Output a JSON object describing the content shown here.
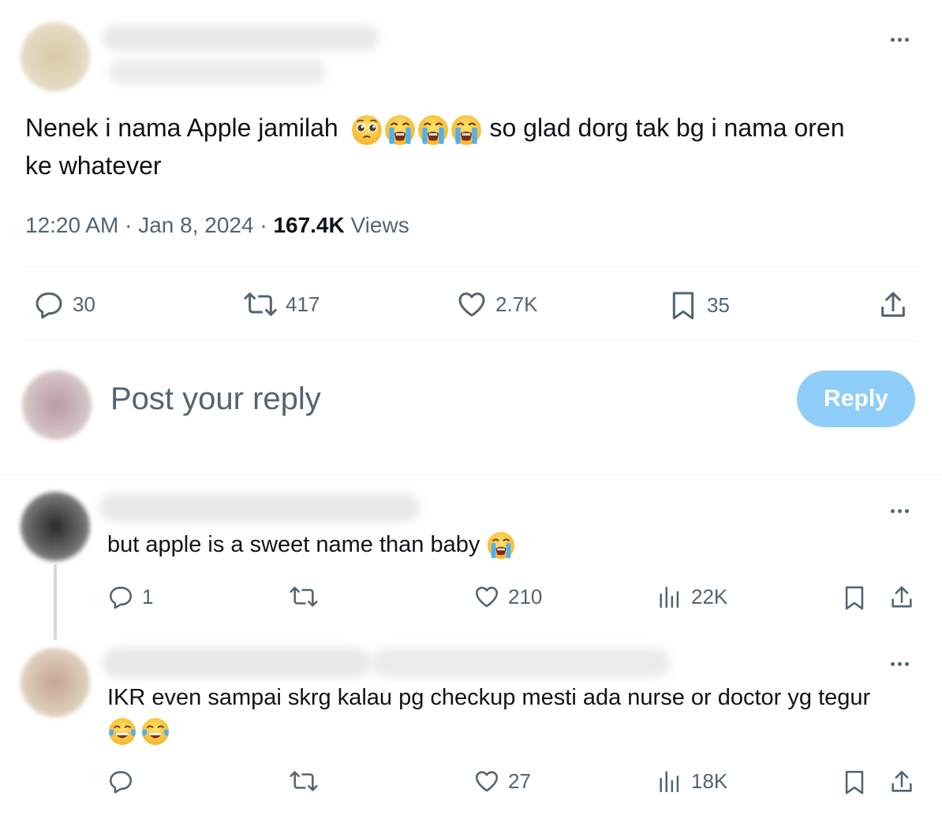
{
  "main_tweet": {
    "text_before_emoji": "Nenek i nama Apple jamilah",
    "text_after_emoji": " so glad dorg tak bg i nama oren",
    "text_line2": "ke whatever",
    "emojis": [
      "pleading-face-icon",
      "loudly-crying-face-icon",
      "loudly-crying-face-icon",
      "loudly-crying-face-icon"
    ],
    "time": "12:20 AM",
    "separator": "·",
    "date": "Jan 8, 2024",
    "views_count": "167.4K",
    "views_label": "Views",
    "actions": {
      "replies": "30",
      "reposts": "417",
      "likes": "2.7K",
      "bookmarks": "35"
    }
  },
  "reply_composer": {
    "placeholder": "Post your reply",
    "button_label": "Reply"
  },
  "replies": [
    {
      "text": "but apple is a sweet name than baby",
      "emojis": [
        "loudly-crying-face-icon"
      ],
      "actions": {
        "replies": "1",
        "reposts": "",
        "likes": "210",
        "views": "22K"
      }
    },
    {
      "text": "IKR even sampai skrg kalau pg checkup mesti ada nurse or doctor yg tegur",
      "emojis": [
        "face-with-tears-of-joy-icon",
        "face-with-tears-of-joy-icon"
      ],
      "actions": {
        "replies": "",
        "reposts": "",
        "likes": "27",
        "views": "18K"
      }
    }
  ],
  "colors": {
    "text_primary": "#0f1419",
    "text_secondary": "#536471",
    "reply_button_disabled": "#8ecdf8",
    "divider": "#eff3f4"
  }
}
